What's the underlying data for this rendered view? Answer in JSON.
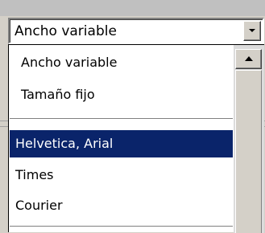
{
  "font_select": {
    "selected_value": "Ancho variable",
    "dropdown_arrow_icon": "chevron-down-icon",
    "options": [
      {
        "label": "Ancho variable",
        "selected": false
      },
      {
        "label": "Tamaño fijo",
        "selected": false
      },
      {
        "label": "Helvetica, Arial",
        "selected": true
      },
      {
        "label": "Times",
        "selected": false
      },
      {
        "label": "Courier",
        "selected": false
      }
    ],
    "scrollbar": {
      "up_arrow_icon": "chevron-up-icon"
    }
  },
  "colors": {
    "selection": "#0a246a",
    "selection_text": "#ffffff",
    "face": "#d4d0c8"
  }
}
